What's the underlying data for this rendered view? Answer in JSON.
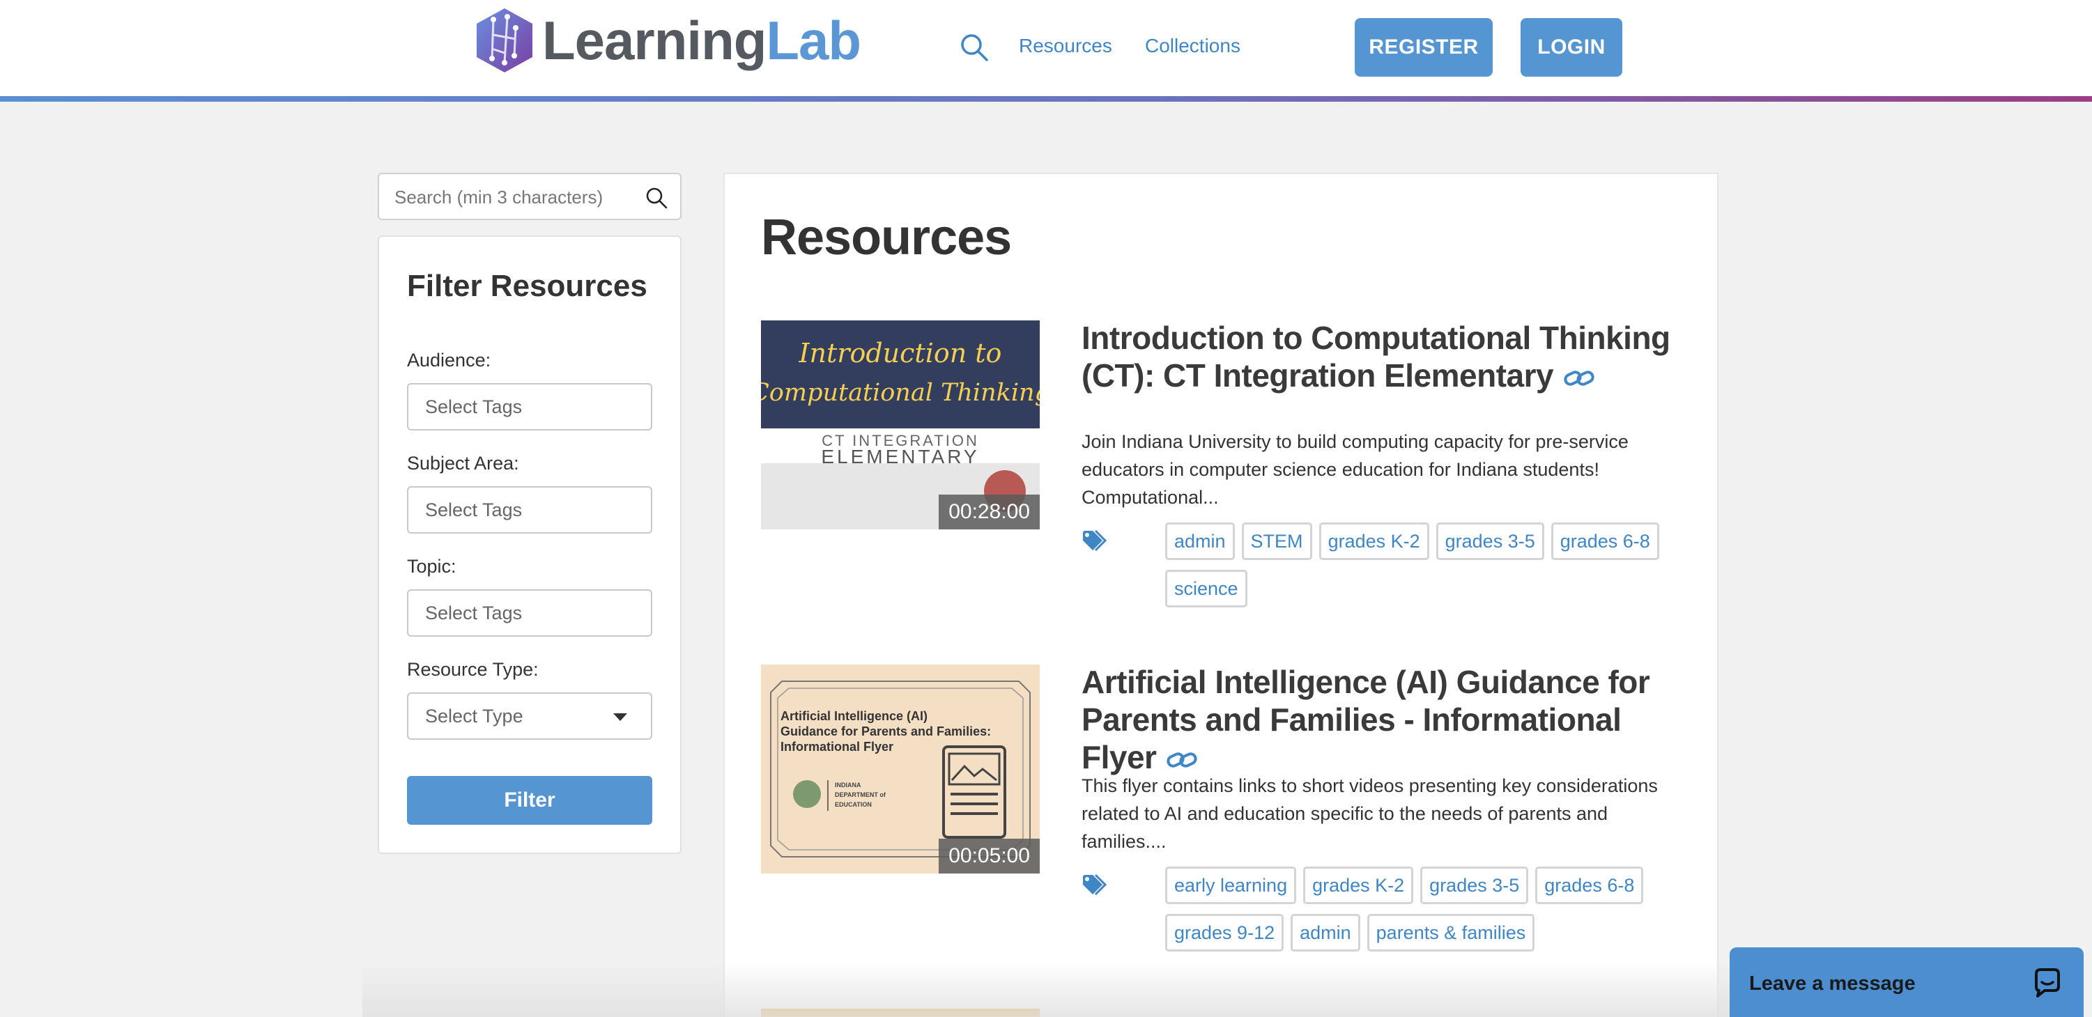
{
  "header": {
    "logo_part1": "Learning",
    "logo_part2": "Lab",
    "nav": [
      "Resources",
      "Collections"
    ],
    "register_label": "REGISTER",
    "login_label": "LOGIN",
    "search_icon": "search-icon"
  },
  "sidebar": {
    "search_placeholder": "Search (min 3 characters)",
    "filter_title": "Filter Resources",
    "fields": [
      {
        "label": "Audience:",
        "value": "Select Tags"
      },
      {
        "label": "Subject Area:",
        "value": "Select Tags"
      },
      {
        "label": "Topic:",
        "value": "Select Tags"
      },
      {
        "label": "Resource Type:",
        "value": "Select Type"
      }
    ],
    "filter_button": "Filter"
  },
  "main": {
    "title": "Resources",
    "resources": [
      {
        "thumb_line1": "Introduction to",
        "thumb_line2": "Computational Thinking",
        "thumb_line3": "CT INTEGRATION",
        "thumb_line4": "ELEMENTARY",
        "duration": "00:28:00",
        "title": "Introduction to Computational Thinking (CT): CT Integration Elementary",
        "description": "Join Indiana University to build computing capacity for pre-service educators in computer science education for Indiana students! Computational...",
        "tags": [
          "admin",
          "STEM",
          "grades K-2",
          "grades 3-5",
          "grades 6-8",
          "science"
        ]
      },
      {
        "thumb_line1": "Artificial Intelligence (AI)",
        "thumb_line2": "Guidance for Parents and Families:",
        "thumb_line3": "Informational Flyer",
        "thumb_line4": "INDIANA",
        "thumb_line5": "DEPARTMENT of",
        "thumb_line6": "EDUCATION",
        "duration": "00:05:00",
        "title": "Artificial Intelligence (AI) Guidance for Parents and Families - Informational Flyer",
        "description": "This flyer contains links to short videos presenting key considerations related to AI and education specific to the needs of parents and families....",
        "tags": [
          "early learning",
          "grades K-2",
          "grades 3-5",
          "grades 6-8",
          "grades 9-12",
          "admin",
          "parents & families"
        ]
      }
    ]
  },
  "chat": {
    "label": "Leave a message"
  },
  "colors": {
    "accent": "#5495d2",
    "link": "#3f86c6",
    "title": "#333333"
  }
}
